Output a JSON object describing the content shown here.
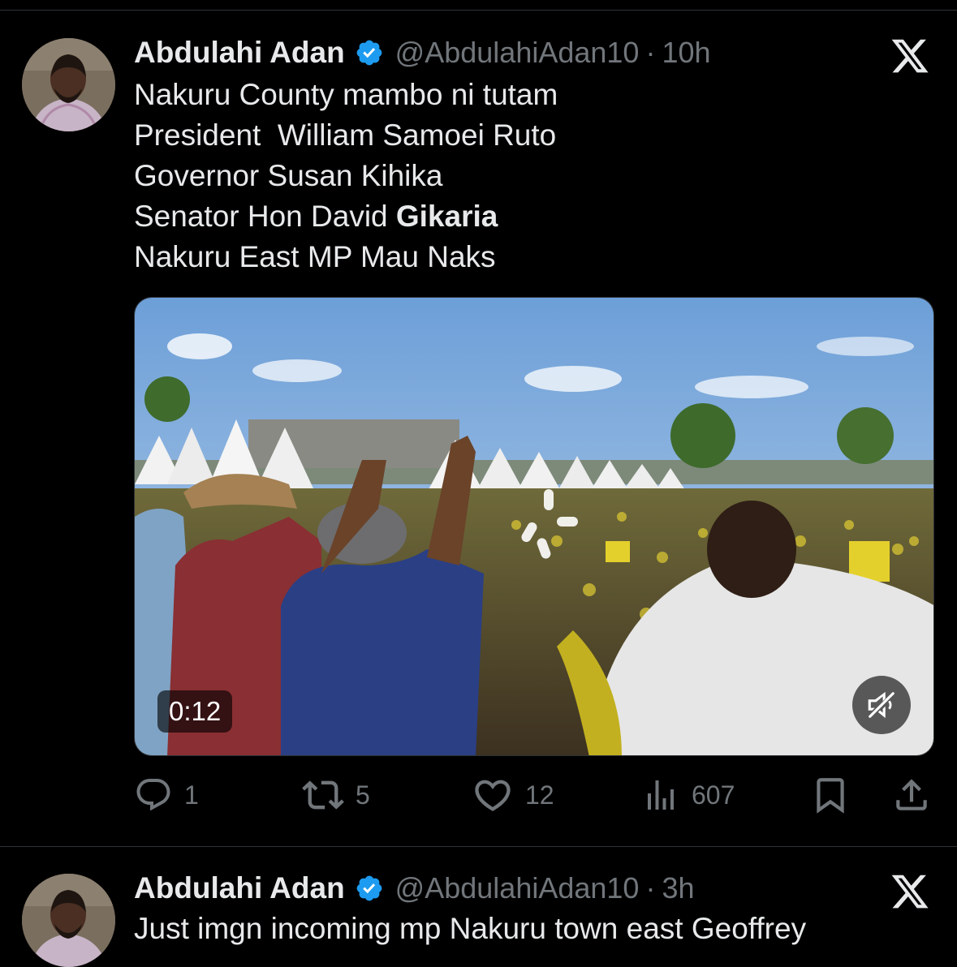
{
  "tweets": [
    {
      "author_name": "Abdulahi Adan",
      "handle": "@AbdulahiAdan10",
      "separator": "·",
      "time": "10h",
      "lines": [
        "Nakuru County mambo ni tutam",
        "President  William Samoei Ruto",
        "Governor Susan Kihika",
        "Senator Hon David ",
        "Nakuru East MP Mau Naks"
      ],
      "bold_fragment": "Gikaria",
      "video_duration": "0:12",
      "stats": {
        "replies": "1",
        "reposts": "5",
        "likes": "12",
        "views": "607"
      }
    },
    {
      "author_name": "Abdulahi Adan",
      "handle": "@AbdulahiAdan10",
      "separator": "·",
      "time": "3h",
      "lines": [
        "Just imgn incoming mp Nakuru town east Geoffrey"
      ]
    }
  ],
  "icons": {
    "verified": "verified-badge-icon",
    "platform": "x-logo-icon",
    "reply": "reply-icon",
    "repost": "repost-icon",
    "like": "like-icon",
    "views": "views-icon",
    "bookmark": "bookmark-icon",
    "share": "share-icon",
    "mute": "mute-icon"
  },
  "colors": {
    "background": "#000000",
    "text": "#e7e9ea",
    "secondary": "#71767b",
    "verified_blue": "#1d9bf0",
    "divider": "#2f3336"
  }
}
